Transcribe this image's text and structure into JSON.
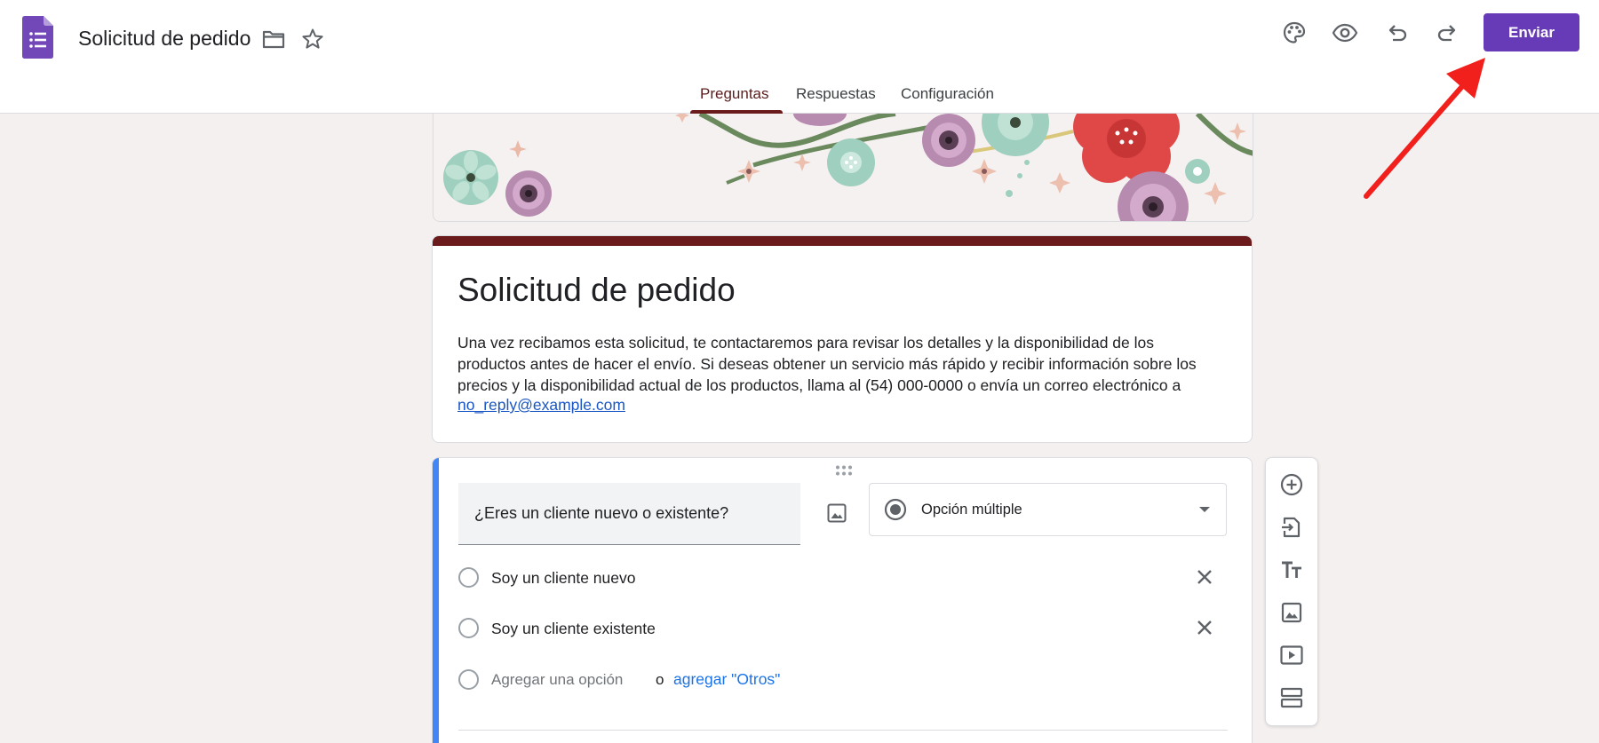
{
  "header": {
    "doc_title": "Solicitud de pedido",
    "send_label": "Enviar",
    "accent_color": "#673ab7",
    "icons": [
      "folder-icon",
      "star-icon",
      "palette-icon",
      "eye-icon",
      "undo-icon",
      "redo-icon"
    ]
  },
  "tabs": [
    {
      "label": "Preguntas",
      "active": true
    },
    {
      "label": "Respuestas",
      "active": false
    },
    {
      "label": "Configuración",
      "active": false
    }
  ],
  "form": {
    "title": "Solicitud de pedido",
    "description": "Una vez recibamos esta solicitud, te contactaremos para revisar los detalles y la disponibilidad de los productos antes de hacer el envío. Si deseas obtener un servicio más rápido y recibir información sobre los precios y la disponibilidad actual de los productos, llama al (54) 000-0000 o envía un correo electrónico a",
    "email_link": "no_reply@example.com",
    "theme_color": "#6b1b1b"
  },
  "question": {
    "title": "¿Eres un cliente nuevo o existente?",
    "type_label": "Opción múltiple",
    "options": [
      {
        "label": "Soy un cliente nuevo"
      },
      {
        "label": "Soy un cliente existente"
      }
    ],
    "add_option": "Agregar una opción",
    "or": "o",
    "add_other": "agregar \"Otros\""
  },
  "toolbar": {
    "tools": [
      "add-question-icon",
      "import-questions-icon",
      "add-title-icon",
      "add-image-icon",
      "add-video-icon",
      "add-section-icon"
    ]
  }
}
